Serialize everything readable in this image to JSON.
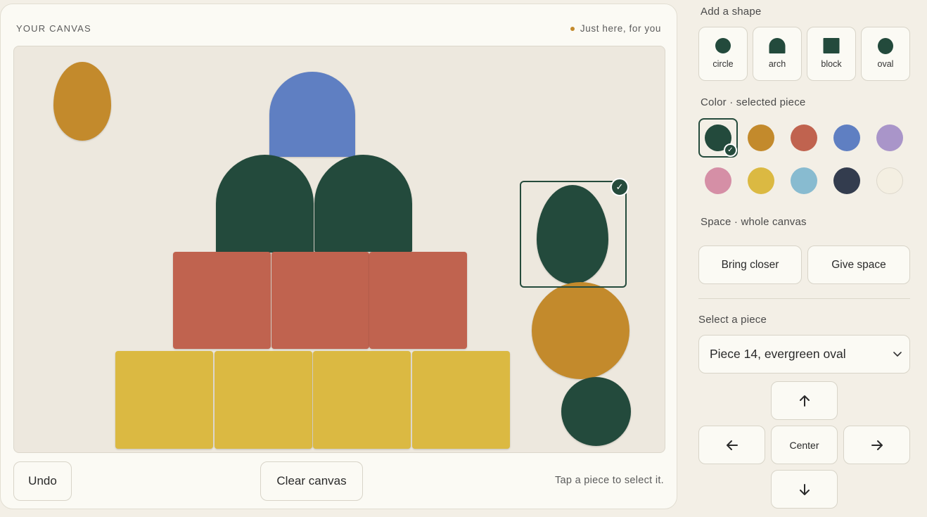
{
  "canvas": {
    "title": "YOUR CANVAS",
    "hint": "Just here, for you",
    "undo_label": "Undo",
    "clear_label": "Clear canvas",
    "tap_hint": "Tap a piece to select it."
  },
  "panel": {
    "add_shape_label": "Add a shape",
    "shapes": [
      {
        "label": "circle",
        "icon": "circle-icon"
      },
      {
        "label": "arch",
        "icon": "arch-icon"
      },
      {
        "label": "block",
        "icon": "block-icon"
      },
      {
        "label": "oval",
        "icon": "oval-icon"
      }
    ],
    "color_label": "Color · selected piece",
    "colors": [
      "#234a3c",
      "#c38a2c",
      "#c0634f",
      "#5f7fc2",
      "#a995c9",
      "#d58fa6",
      "#dbb942",
      "#88bbd0",
      "#333c4e",
      "#f4efe2"
    ],
    "selected_color": "#234a3c",
    "space_label": "Space · whole canvas",
    "bring_closer_label": "Bring closer",
    "give_space_label": "Give space",
    "select_piece_label": "Select a piece",
    "selected_piece": "Piece 14, evergreen oval",
    "center_label": "Center"
  },
  "pieces": [
    {
      "shape": "oval",
      "color": "#c38a2c"
    },
    {
      "shape": "arch",
      "color": "#5f7fc2"
    },
    {
      "shape": "arch",
      "color": "#234a3c"
    },
    {
      "shape": "arch",
      "color": "#234a3c"
    },
    {
      "shape": "block",
      "color": "#c0634f"
    },
    {
      "shape": "block",
      "color": "#c0634f"
    },
    {
      "shape": "block",
      "color": "#c0634f"
    },
    {
      "shape": "block",
      "color": "#dbb942"
    },
    {
      "shape": "block",
      "color": "#dbb942"
    },
    {
      "shape": "block",
      "color": "#dbb942"
    },
    {
      "shape": "block",
      "color": "#dbb942"
    },
    {
      "shape": "oval",
      "color": "#234a3c",
      "selected": true
    },
    {
      "shape": "circle",
      "color": "#c38a2c"
    },
    {
      "shape": "circle",
      "color": "#234a3c"
    }
  ]
}
